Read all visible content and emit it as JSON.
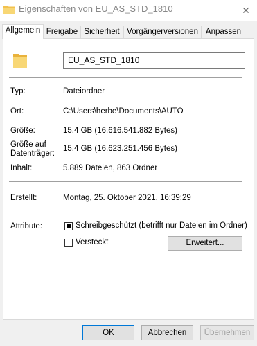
{
  "window": {
    "title": "Eigenschaften von EU_AS_STD_1810",
    "close_glyph": "✕",
    "folder_color": "#f2c14e"
  },
  "tabs": [
    {
      "label": "Allgemein",
      "active": true
    },
    {
      "label": "Freigabe"
    },
    {
      "label": "Sicherheit"
    },
    {
      "label": "Vorgängerversionen"
    },
    {
      "label": "Anpassen"
    }
  ],
  "general": {
    "name": "EU_AS_STD_1810",
    "type_label": "Typ:",
    "type_value": "Dateiordner",
    "location_label": "Ort:",
    "location_value": "C:\\Users\\herbe\\Documents\\AUTO",
    "size_label": "Größe:",
    "size_value": "15.4 GB (16.616.541.882 Bytes)",
    "disk_size_label_line1": "Größe auf",
    "disk_size_label_line2": "Datenträger:",
    "disk_size_value": "15.4 GB (16.623.251.456 Bytes)",
    "contents_label": "Inhalt:",
    "contents_value": "5.889 Dateien, 863 Ordner",
    "created_label": "Erstellt:",
    "created_value": "Montag, 25. Oktober 2021, 16:39:29",
    "attributes_label": "Attribute:",
    "readonly_label": "Schreibgeschützt (betrifft nur Dateien im Ordner)",
    "hidden_label": "Versteckt",
    "advanced_button": "Erweitert..."
  },
  "footer": {
    "ok": "OK",
    "cancel": "Abbrechen",
    "apply": "Übernehmen"
  }
}
